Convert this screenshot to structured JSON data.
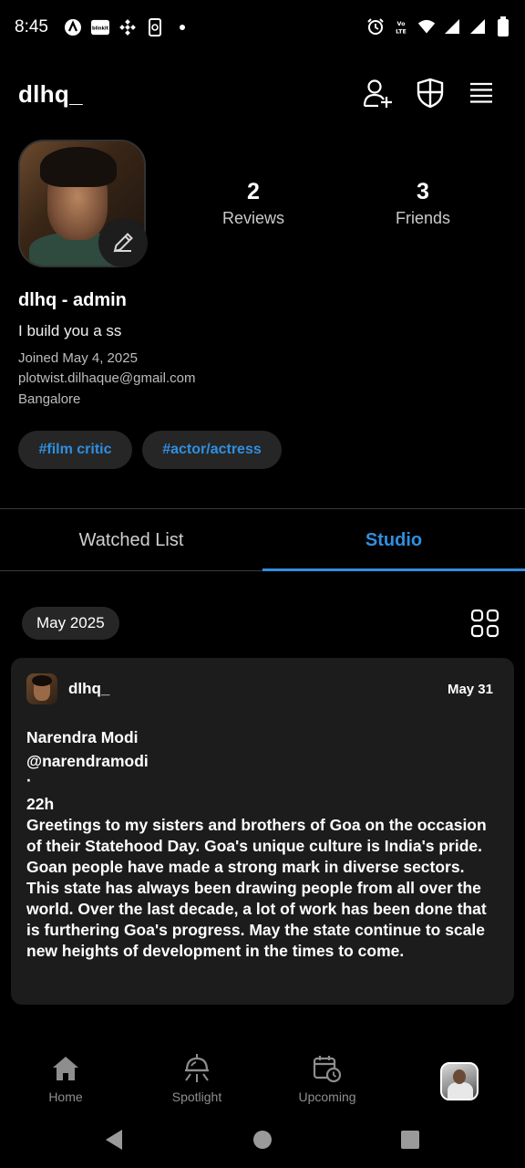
{
  "status_bar": {
    "time": "8:45",
    "left_icons": [
      "arc-icon",
      "blinkit-icon",
      "binance-icon",
      "phone-link-icon",
      "dot-icon"
    ],
    "right_icons": [
      "alarm-icon",
      "volte-icon",
      "wifi-icon",
      "signal-icon",
      "signal-icon",
      "battery-icon"
    ],
    "blinkit_text": "blinkit",
    "volte_text": "Vo LTE"
  },
  "header": {
    "username": "dlhq_",
    "icons": [
      "add-friend-icon",
      "shield-icon",
      "menu-icon"
    ]
  },
  "profile": {
    "stats": [
      {
        "value": "2",
        "label": "Reviews"
      },
      {
        "value": "3",
        "label": "Friends"
      }
    ],
    "display_name": "dlhq - admin",
    "bio": "I build you a ss",
    "joined": "Joined May 4, 2025",
    "email": "plotwist.dilhaque@gmail.com",
    "location": "Bangalore",
    "tags": [
      "#film critic",
      "#actor/actress"
    ]
  },
  "tabs": {
    "items": [
      "Watched List",
      "Studio"
    ],
    "active": "Studio",
    "active_color": "#2f8fe0"
  },
  "studio": {
    "month_filter": "May 2025",
    "view_icon": "grid-icon"
  },
  "post": {
    "user": "dlhq_",
    "date": "May 31",
    "author_name": "Narendra Modi",
    "handle": "@narendramodi",
    "separator": "·",
    "time_ago": "22h",
    "body": "Greetings to my sisters and brothers of Goa on the occasion of their Statehood Day. Goa's unique culture is India's pride. Goan people have made a strong mark in diverse sectors. This state has always been drawing people from all over the world. Over the last decade, a lot of work has been done that is furthering Goa's progress. May the state continue to scale new heights of development in the times to come."
  },
  "bottom_nav": {
    "items": [
      {
        "label": "Home",
        "icon": "home-icon"
      },
      {
        "label": "Spotlight",
        "icon": "spotlight-icon"
      },
      {
        "label": "Upcoming",
        "icon": "calendar-clock-icon"
      }
    ],
    "profile_icon": "profile-avatar"
  },
  "system_nav": [
    "back-icon",
    "home-circle-icon",
    "recents-icon"
  ]
}
